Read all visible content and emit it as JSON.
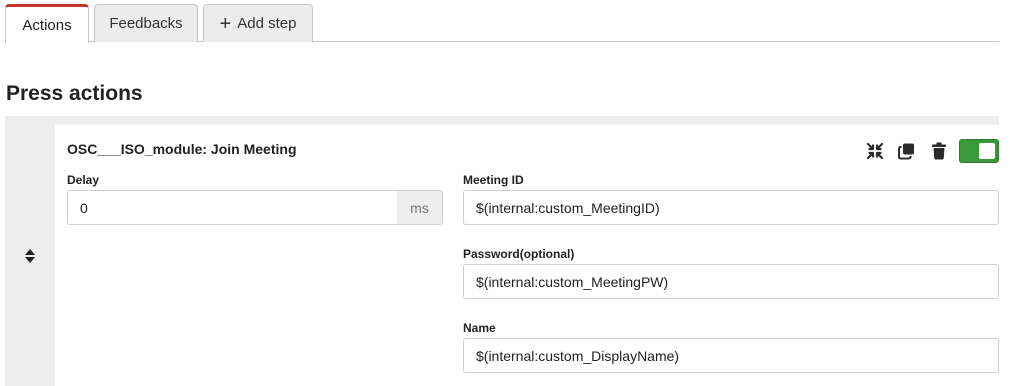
{
  "tabs": [
    {
      "label": "Actions",
      "active": true
    },
    {
      "label": "Feedbacks",
      "active": false
    },
    {
      "label": "Add step",
      "active": false
    }
  ],
  "section_title": "Press actions",
  "action": {
    "title": "OSC___ISO_module: Join Meeting",
    "enabled": true,
    "delay": {
      "label": "Delay",
      "value": "0",
      "unit": "ms"
    },
    "fields": [
      {
        "label": "Meeting ID",
        "value": "$(internal:custom_MeetingID)"
      },
      {
        "label": "Password(optional)",
        "value": "$(internal:custom_MeetingPW)"
      },
      {
        "label": "Name",
        "value": "$(internal:custom_DisplayName)"
      }
    ],
    "tools": [
      "collapse-icon",
      "duplicate-icon",
      "delete-icon",
      "enable-toggle"
    ]
  },
  "colors": {
    "accent_tab": "#c0392b",
    "toggle_on": "#3a9a3a"
  }
}
